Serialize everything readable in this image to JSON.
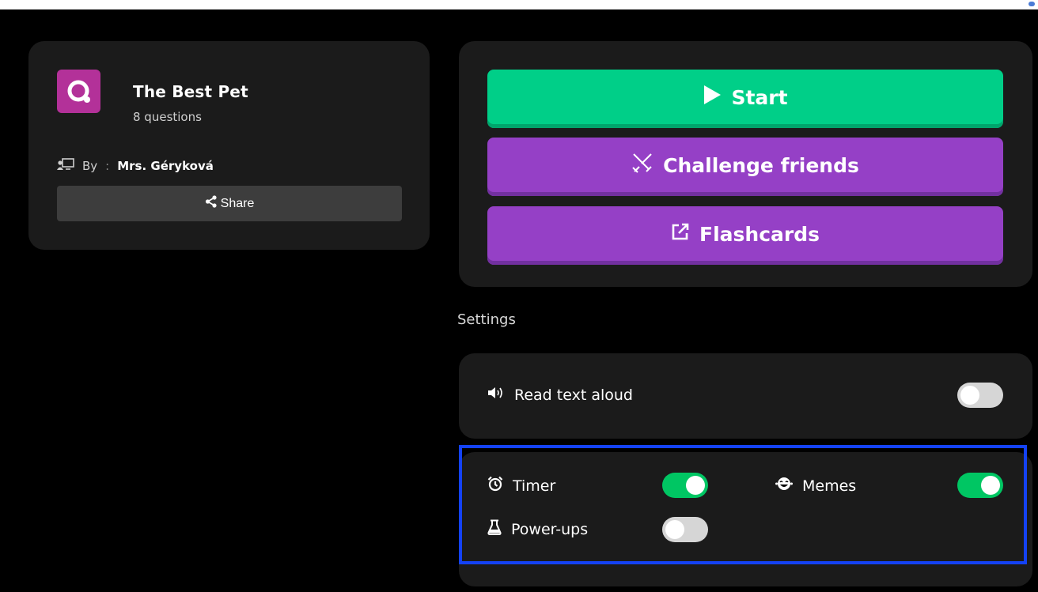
{
  "quiz": {
    "title": "The Best Pet",
    "subtitle": "8 questions",
    "by_label": "By",
    "colon": ":",
    "author": "Mrs. Géryková",
    "share_label": "Share"
  },
  "actions": {
    "start_label": "Start",
    "challenge_label": "Challenge friends",
    "flashcards_label": "Flashcards"
  },
  "settings": {
    "heading": "Settings",
    "read_aloud": {
      "label": "Read text aloud",
      "enabled": false
    },
    "timer": {
      "label": "Timer",
      "enabled": true
    },
    "memes": {
      "label": "Memes",
      "enabled": true
    },
    "powerups": {
      "label": "Power-ups",
      "enabled": false
    }
  },
  "colors": {
    "start": "#00cf88",
    "purple": "#9540c6",
    "toggle_on": "#00c663",
    "logo": "#b33199",
    "highlight": "#1442f5"
  },
  "icons": {
    "logo": "quizizz-q-icon",
    "author": "teacher-board-icon",
    "share": "share-icon",
    "start": "play-icon",
    "challenge": "swords-icon",
    "flashcards": "external-link-icon",
    "read_aloud": "speaker-icon",
    "timer": "alarm-clock-icon",
    "memes": "laughing-face-icon",
    "powerups": "potion-flask-icon"
  }
}
